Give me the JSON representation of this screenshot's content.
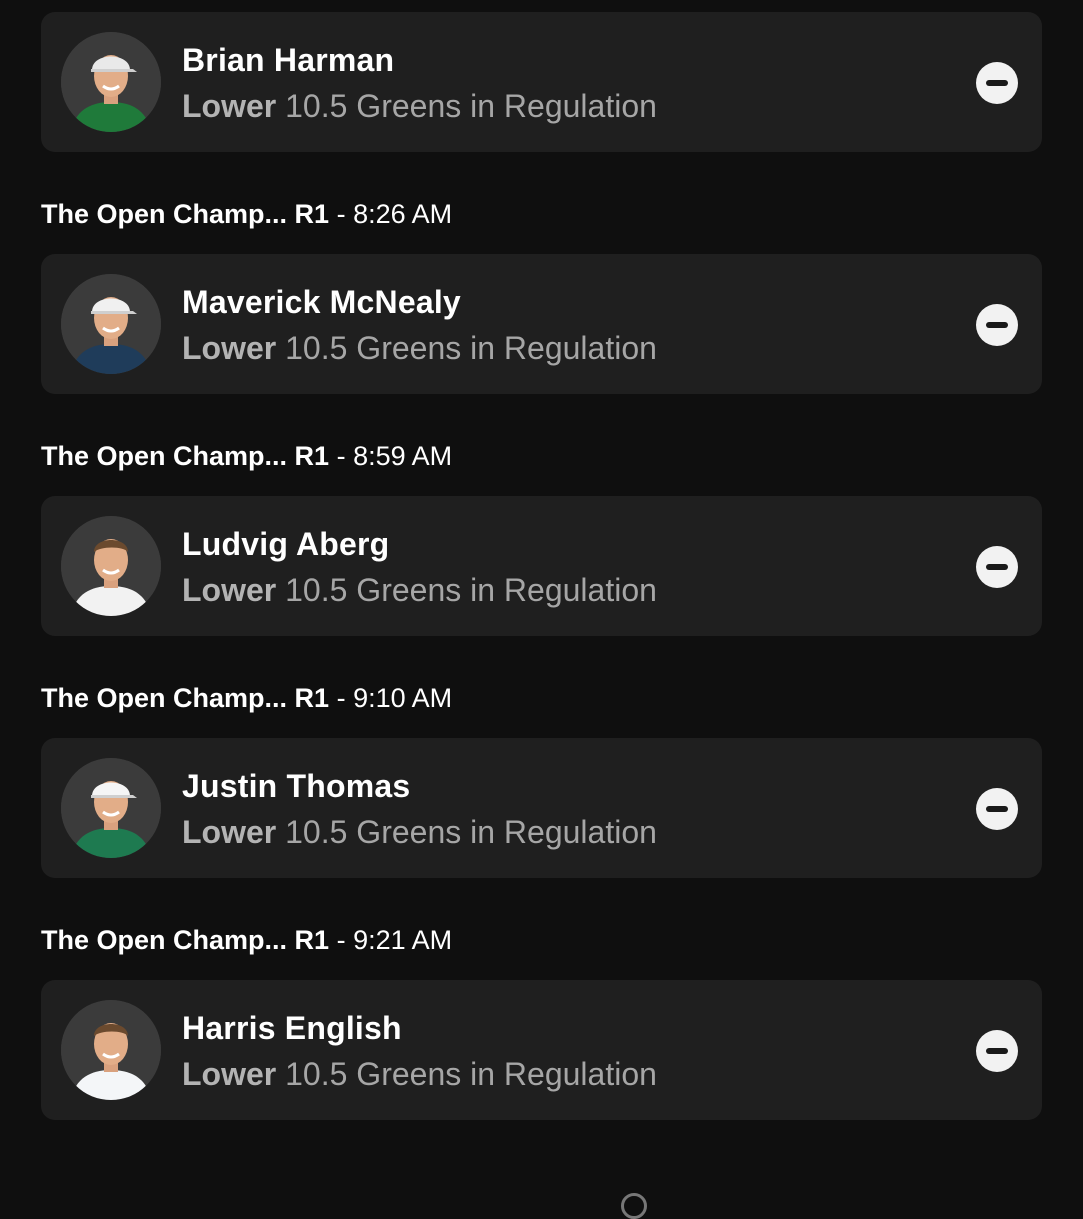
{
  "picks": [
    {
      "header": null,
      "player": "Brian Harman",
      "direction": "Lower",
      "line": "10.5",
      "stat": "Greens in Regulation",
      "avatar_icon": "player-headshot-icon",
      "shirt_color": "#1f7a3a",
      "cap_color": "#e9e9e9"
    },
    {
      "header": {
        "event": "The Open Champ... R1",
        "separator": "-",
        "time": "8:26 AM"
      },
      "player": "Maverick McNealy",
      "direction": "Lower",
      "line": "10.5",
      "stat": "Greens in Regulation",
      "avatar_icon": "player-headshot-icon",
      "shirt_color": "#1f3c5a",
      "cap_color": "#f0f0f0"
    },
    {
      "header": {
        "event": "The Open Champ... R1",
        "separator": "-",
        "time": "8:59 AM"
      },
      "player": "Ludvig Aberg",
      "direction": "Lower",
      "line": "10.5",
      "stat": "Greens in Regulation",
      "avatar_icon": "player-headshot-icon",
      "shirt_color": "#f2f2f2",
      "cap_color": null
    },
    {
      "header": {
        "event": "The Open Champ... R1",
        "separator": "-",
        "time": "9:10 AM"
      },
      "player": "Justin Thomas",
      "direction": "Lower",
      "line": "10.5",
      "stat": "Greens in Regulation",
      "avatar_icon": "player-headshot-icon",
      "shirt_color": "#1e7a50",
      "cap_color": "#f5f5f5"
    },
    {
      "header": {
        "event": "The Open Champ... R1",
        "separator": "-",
        "time": "9:21 AM"
      },
      "player": "Harris English",
      "direction": "Lower",
      "line": "10.5",
      "stat": "Greens in Regulation",
      "avatar_icon": "player-headshot-icon",
      "shirt_color": "#f4f6f8",
      "cap_color": null
    }
  ],
  "remove_icon": "minus-circle-icon",
  "colors": {
    "background": "#0f0f0f",
    "card": "#1f1f1f",
    "secondary_text": "#a6a6a6",
    "button": "#f2f2f2"
  }
}
